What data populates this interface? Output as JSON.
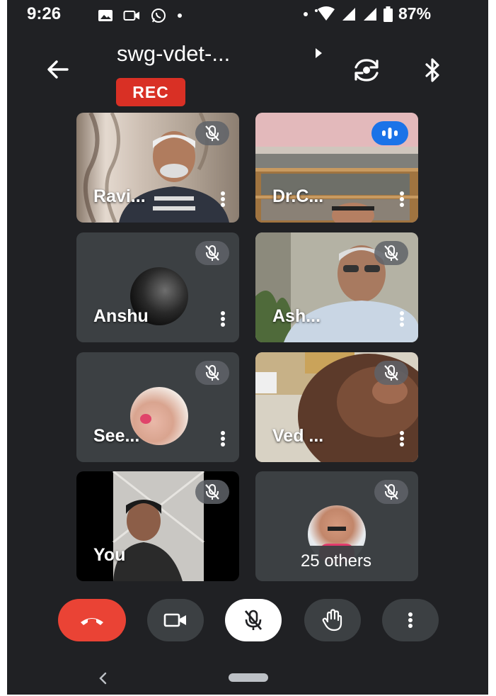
{
  "status_bar": {
    "time": "9:26",
    "battery": "87%",
    "left_icons": [
      "gallery-icon",
      "video-call-icon",
      "whatsapp-icon",
      "dot-icon"
    ],
    "right_icons": [
      "dot-icon",
      "wifi-icon",
      "signal-icon",
      "signal-icon",
      "battery-icon"
    ]
  },
  "header": {
    "meeting_title": "swg-vdet-...",
    "rec_label": "REC"
  },
  "tiles": [
    {
      "name": "Ravi...",
      "muted": true
    },
    {
      "name": "Dr.C...",
      "speaking": true
    },
    {
      "name": "Anshu",
      "muted": true
    },
    {
      "name": "Ash...",
      "muted": true
    },
    {
      "name": "See...",
      "muted": true
    },
    {
      "name": "Ved ...",
      "muted": true
    },
    {
      "name": "You",
      "muted": true
    },
    {
      "name": "",
      "muted": true,
      "others_label": "25 others"
    }
  ],
  "controls": [
    "end-call",
    "camera",
    "microphone-off",
    "raise-hand",
    "more-options"
  ],
  "colors": {
    "background": "#202124",
    "tile": "#3c4043",
    "rec": "#d93025",
    "end_call": "#ea4335",
    "speaking": "#1a73e8"
  }
}
